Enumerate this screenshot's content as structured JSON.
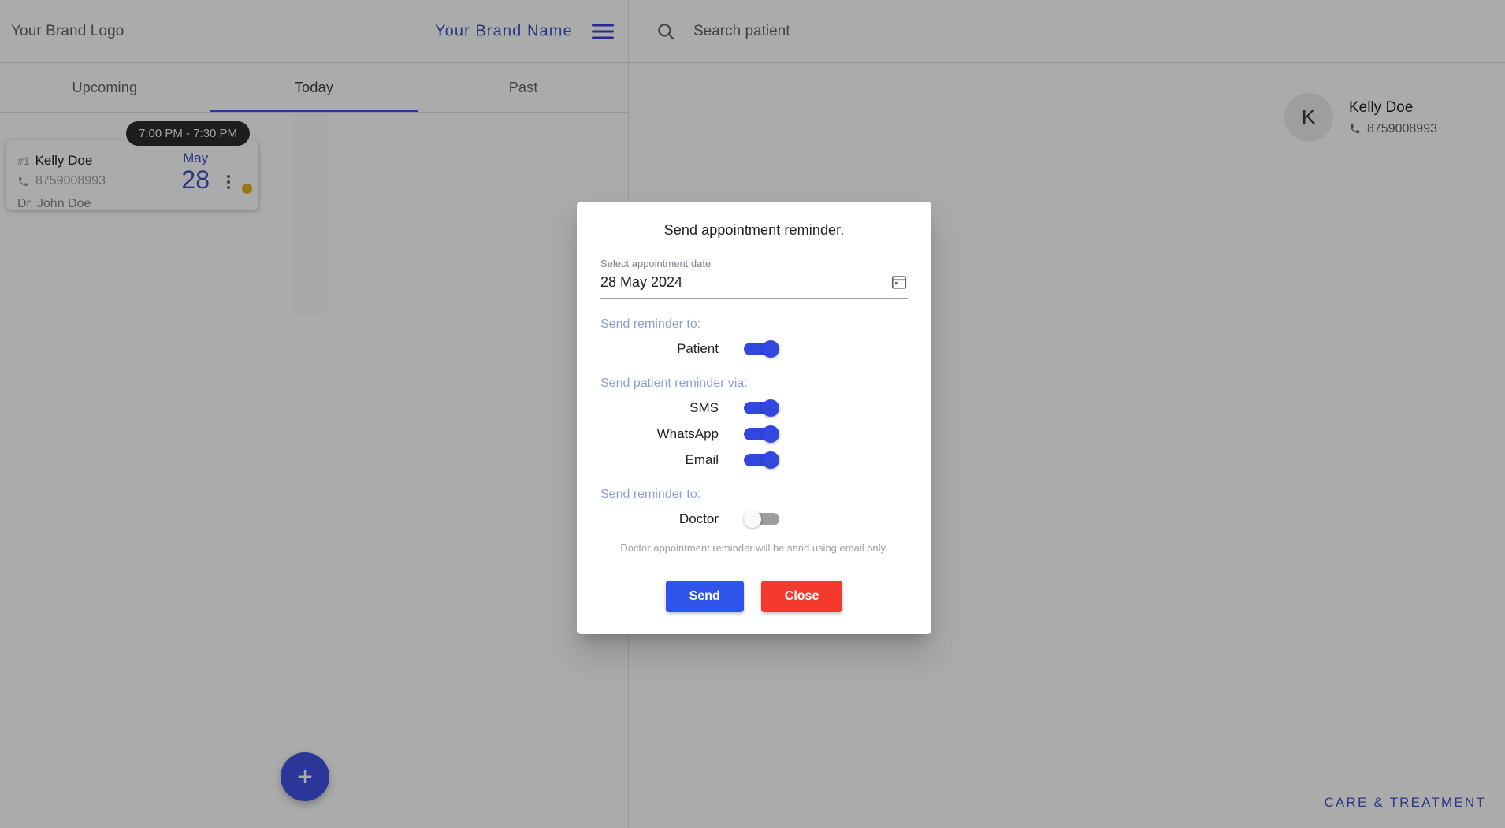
{
  "left_pane": {
    "header": {
      "logo_text": "Your Brand Logo",
      "brand_name": "Your Brand Name",
      "menu_icon": "hamburger-menu-icon"
    },
    "tabs": [
      {
        "label": "Upcoming",
        "active": false
      },
      {
        "label": "Today",
        "active": true
      },
      {
        "label": "Past",
        "active": false
      }
    ],
    "appointment_card": {
      "time_pill": "7:00 PM - 7:30 PM",
      "index": "#1",
      "patient_name": "Kelly Doe",
      "phone": "8759008993",
      "phone_icon": "phone-icon",
      "doctor": "Dr. John Doe",
      "month": "May",
      "day": "28",
      "menu_icon": "more-vertical-icon",
      "status_color": "#e8b21a"
    },
    "fab_label": "+"
  },
  "right_pane": {
    "search": {
      "placeholder": "Search patient",
      "value": "",
      "icon": "search-icon"
    },
    "patient": {
      "avatar_initial": "K",
      "name": "Kelly Doe",
      "phone": "8759008993",
      "phone_icon": "phone-icon"
    },
    "fab_label": "+",
    "footer_note": "CARE & TREATMENT"
  },
  "modal": {
    "title": "Send appointment reminder.",
    "date_field": {
      "label": "Select appointment date",
      "value": "28 May 2024",
      "icon": "calendar-icon"
    },
    "group_patient_label": "Send reminder to:",
    "group_via_label": "Send patient reminder via:",
    "group_doctor_label": "Send reminder to:",
    "toggles_patient": [
      {
        "label": "Patient",
        "on": true
      }
    ],
    "toggles_via": [
      {
        "label": "SMS",
        "on": true
      },
      {
        "label": "WhatsApp",
        "on": true
      },
      {
        "label": "Email",
        "on": true
      }
    ],
    "toggles_doctor": [
      {
        "label": "Doctor",
        "on": false
      }
    ],
    "helper_text": "Doctor appointment reminder will be send using email only.",
    "send_label": "Send",
    "close_label": "Close",
    "send_color": "#2f54eb",
    "close_color": "#f4392f",
    "accent_color": "#3246e0"
  }
}
